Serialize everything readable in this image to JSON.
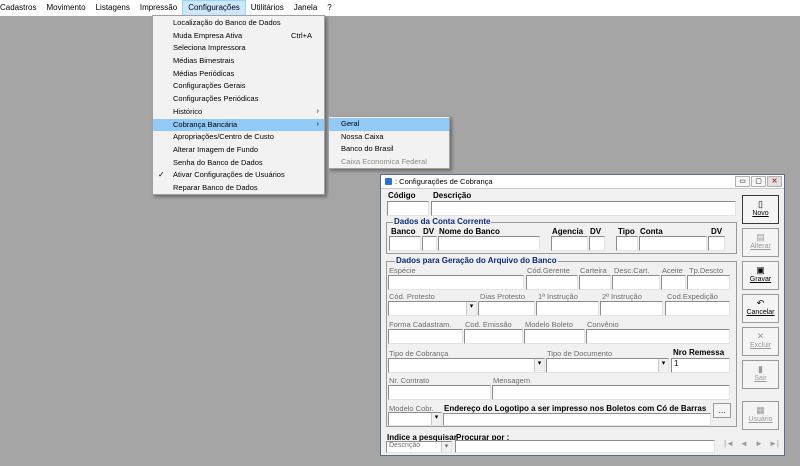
{
  "menubar": {
    "items": [
      "Cadastros",
      "Movimento",
      "Listagens",
      "Impressão",
      "Configurações",
      "Utilitários",
      "Janela",
      "?"
    ]
  },
  "config_menu": {
    "items": [
      {
        "label": "Localização do Banco de Dados"
      },
      {
        "label": "Muda Empresa Ativa",
        "shortcut": "Ctrl+A"
      },
      {
        "label": "Seleciona Impressora"
      },
      {
        "label": "Médias Bimestrais"
      },
      {
        "label": "Médias Periódicas"
      },
      {
        "label": "Configurações Gerais"
      },
      {
        "label": "Configurações Periódicas"
      },
      {
        "label": "Histórico",
        "arrow": "›"
      },
      {
        "label": "Cobrança Bancária",
        "arrow": "›"
      },
      {
        "label": "Apropriações/Centro de Custo"
      },
      {
        "label": "Alterar Imagem de Fundo"
      },
      {
        "label": "Senha do Banco de Dados"
      },
      {
        "label": "Ativar Configurações de Usuários",
        "check": "✓"
      },
      {
        "label": "Reparar Banco de Dados"
      }
    ]
  },
  "submenu": {
    "items": [
      "Geral",
      "Nossa Caixa",
      "Banco do Brasil",
      "Caixa Economica Federal"
    ]
  },
  "window": {
    "title": ": Configurações de Cobrança",
    "buttons": {
      "minimize": "▭",
      "maximize": "▢",
      "close": "✕"
    },
    "codigo_label": "Código",
    "descricao_label": "Descrição",
    "conta_group": "Dados da Conta Corrente",
    "banco_label": "Banco",
    "dv_label": "DV",
    "nome_banco_label": "Nome do Banco",
    "agencia_label": "Agencia",
    "dv2_label": "DV",
    "tipo_label": "Tipo",
    "conta_label": "Conta",
    "dv3_label": "DV",
    "arquivo_group": "Dados para Geração do Arquivo do Banco",
    "especie_label": "Espécie",
    "cod_gerente_label": "Cód.Gerente",
    "carteira_label": "Carteira",
    "desc_cart_label": "Desc.Cart.",
    "aceite_label": "Aceite",
    "tp_descto_label": "Tp.Descto",
    "cod_protesto_label": "Cód. Protesto",
    "dias_protesto_label": "Dias Protesto",
    "instrucao1_label": "1ª Instrução",
    "instrucao2_label": "2ª Instrução",
    "cod_expedicao_label": "Cod.Expedição",
    "forma_cadastram_label": "Forma Cadastram.",
    "cod_emissao_label": "Cod. Emissão",
    "modelo_boleto_label": "Modelo Boleto",
    "convenio_label": "Convênio",
    "tipo_cobranca_label": "Tipo de Cobrança",
    "tipo_documento_label": "Tipo de Documento",
    "nro_remessa_label": "Nro Remessa",
    "nro_remessa_value": "1",
    "nr_contrato_label": "Nr. Contrato",
    "mensagem_label": "Mensagem",
    "modelo_cobr_label": "Modelo Cobr.",
    "logotipo_label": "Endereço do Logotipo a ser impresso nos Boletos com Có de Barras",
    "browse_label": "...",
    "indice_label": "Indice a pesquisar",
    "indice_value": "Descrição",
    "procurar_label": "Procurar por :",
    "side_buttons": {
      "novo": "Novo",
      "alterar": "Alterar",
      "gravar": "Gravar",
      "cancelar": "Cancelar",
      "excluir": "Excluir",
      "sair": "Sair",
      "usuario": "Usuário"
    },
    "nav": {
      "first": "|◄",
      "prev": "◄",
      "next": "►",
      "last": "►|"
    }
  }
}
